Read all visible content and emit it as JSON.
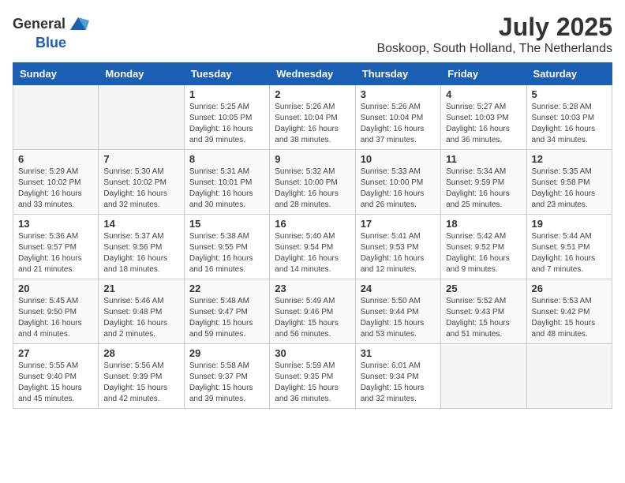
{
  "header": {
    "logo_general": "General",
    "logo_blue": "Blue",
    "month": "July 2025",
    "location": "Boskoop, South Holland, The Netherlands"
  },
  "days_of_week": [
    "Sunday",
    "Monday",
    "Tuesday",
    "Wednesday",
    "Thursday",
    "Friday",
    "Saturday"
  ],
  "weeks": [
    [
      {
        "day": "",
        "info": ""
      },
      {
        "day": "",
        "info": ""
      },
      {
        "day": "1",
        "info": "Sunrise: 5:25 AM\nSunset: 10:05 PM\nDaylight: 16 hours\nand 39 minutes."
      },
      {
        "day": "2",
        "info": "Sunrise: 5:26 AM\nSunset: 10:04 PM\nDaylight: 16 hours\nand 38 minutes."
      },
      {
        "day": "3",
        "info": "Sunrise: 5:26 AM\nSunset: 10:04 PM\nDaylight: 16 hours\nand 37 minutes."
      },
      {
        "day": "4",
        "info": "Sunrise: 5:27 AM\nSunset: 10:03 PM\nDaylight: 16 hours\nand 36 minutes."
      },
      {
        "day": "5",
        "info": "Sunrise: 5:28 AM\nSunset: 10:03 PM\nDaylight: 16 hours\nand 34 minutes."
      }
    ],
    [
      {
        "day": "6",
        "info": "Sunrise: 5:29 AM\nSunset: 10:02 PM\nDaylight: 16 hours\nand 33 minutes."
      },
      {
        "day": "7",
        "info": "Sunrise: 5:30 AM\nSunset: 10:02 PM\nDaylight: 16 hours\nand 32 minutes."
      },
      {
        "day": "8",
        "info": "Sunrise: 5:31 AM\nSunset: 10:01 PM\nDaylight: 16 hours\nand 30 minutes."
      },
      {
        "day": "9",
        "info": "Sunrise: 5:32 AM\nSunset: 10:00 PM\nDaylight: 16 hours\nand 28 minutes."
      },
      {
        "day": "10",
        "info": "Sunrise: 5:33 AM\nSunset: 10:00 PM\nDaylight: 16 hours\nand 26 minutes."
      },
      {
        "day": "11",
        "info": "Sunrise: 5:34 AM\nSunset: 9:59 PM\nDaylight: 16 hours\nand 25 minutes."
      },
      {
        "day": "12",
        "info": "Sunrise: 5:35 AM\nSunset: 9:58 PM\nDaylight: 16 hours\nand 23 minutes."
      }
    ],
    [
      {
        "day": "13",
        "info": "Sunrise: 5:36 AM\nSunset: 9:57 PM\nDaylight: 16 hours\nand 21 minutes."
      },
      {
        "day": "14",
        "info": "Sunrise: 5:37 AM\nSunset: 9:56 PM\nDaylight: 16 hours\nand 18 minutes."
      },
      {
        "day": "15",
        "info": "Sunrise: 5:38 AM\nSunset: 9:55 PM\nDaylight: 16 hours\nand 16 minutes."
      },
      {
        "day": "16",
        "info": "Sunrise: 5:40 AM\nSunset: 9:54 PM\nDaylight: 16 hours\nand 14 minutes."
      },
      {
        "day": "17",
        "info": "Sunrise: 5:41 AM\nSunset: 9:53 PM\nDaylight: 16 hours\nand 12 minutes."
      },
      {
        "day": "18",
        "info": "Sunrise: 5:42 AM\nSunset: 9:52 PM\nDaylight: 16 hours\nand 9 minutes."
      },
      {
        "day": "19",
        "info": "Sunrise: 5:44 AM\nSunset: 9:51 PM\nDaylight: 16 hours\nand 7 minutes."
      }
    ],
    [
      {
        "day": "20",
        "info": "Sunrise: 5:45 AM\nSunset: 9:50 PM\nDaylight: 16 hours\nand 4 minutes."
      },
      {
        "day": "21",
        "info": "Sunrise: 5:46 AM\nSunset: 9:48 PM\nDaylight: 16 hours\nand 2 minutes."
      },
      {
        "day": "22",
        "info": "Sunrise: 5:48 AM\nSunset: 9:47 PM\nDaylight: 15 hours\nand 59 minutes."
      },
      {
        "day": "23",
        "info": "Sunrise: 5:49 AM\nSunset: 9:46 PM\nDaylight: 15 hours\nand 56 minutes."
      },
      {
        "day": "24",
        "info": "Sunrise: 5:50 AM\nSunset: 9:44 PM\nDaylight: 15 hours\nand 53 minutes."
      },
      {
        "day": "25",
        "info": "Sunrise: 5:52 AM\nSunset: 9:43 PM\nDaylight: 15 hours\nand 51 minutes."
      },
      {
        "day": "26",
        "info": "Sunrise: 5:53 AM\nSunset: 9:42 PM\nDaylight: 15 hours\nand 48 minutes."
      }
    ],
    [
      {
        "day": "27",
        "info": "Sunrise: 5:55 AM\nSunset: 9:40 PM\nDaylight: 15 hours\nand 45 minutes."
      },
      {
        "day": "28",
        "info": "Sunrise: 5:56 AM\nSunset: 9:39 PM\nDaylight: 15 hours\nand 42 minutes."
      },
      {
        "day": "29",
        "info": "Sunrise: 5:58 AM\nSunset: 9:37 PM\nDaylight: 15 hours\nand 39 minutes."
      },
      {
        "day": "30",
        "info": "Sunrise: 5:59 AM\nSunset: 9:35 PM\nDaylight: 15 hours\nand 36 minutes."
      },
      {
        "day": "31",
        "info": "Sunrise: 6:01 AM\nSunset: 9:34 PM\nDaylight: 15 hours\nand 32 minutes."
      },
      {
        "day": "",
        "info": ""
      },
      {
        "day": "",
        "info": ""
      }
    ]
  ]
}
